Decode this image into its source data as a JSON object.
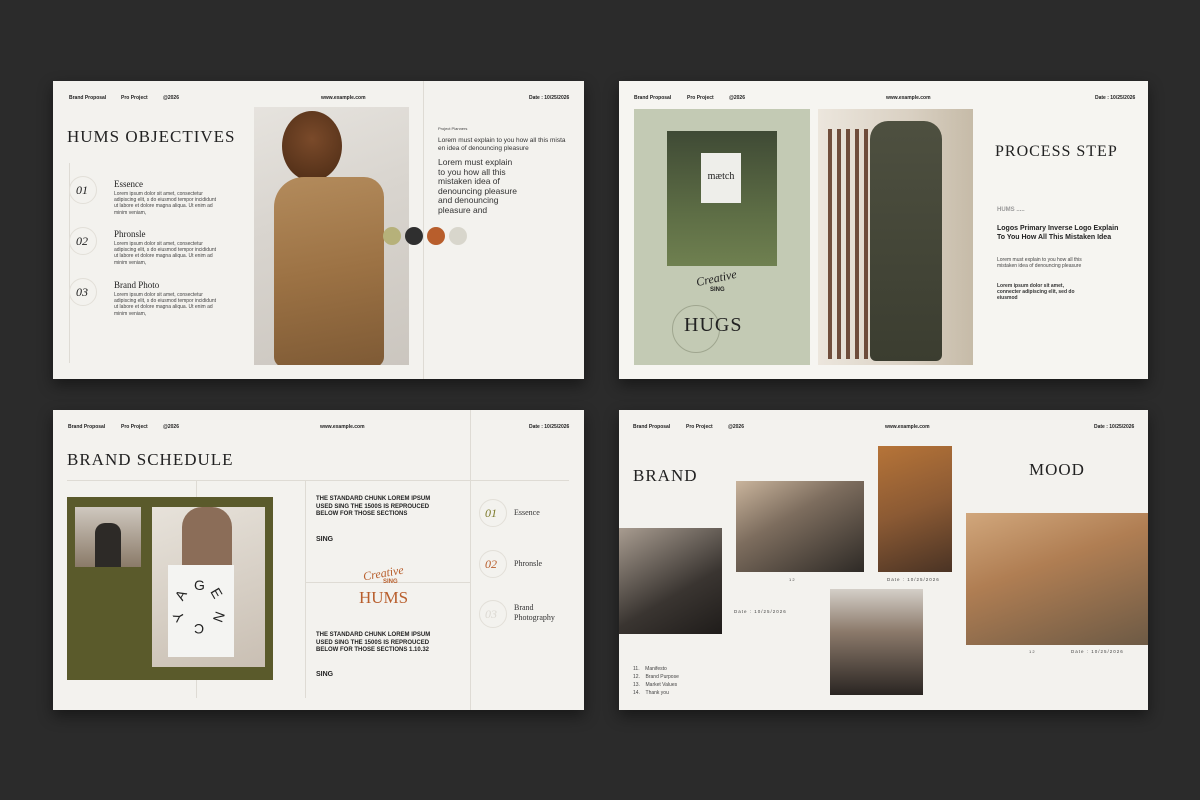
{
  "common": {
    "brand_proposal": "Brand Proposal",
    "pro_project": "Pro Project",
    "year": "@2026",
    "website": "www.example.com",
    "date": "Date : 10/25/2026"
  },
  "slide1": {
    "title": "HUMS OBJECTIVES",
    "project_label": "Project Planners",
    "intro_small": "Lorem must explain to you how all this mista en idea of denouncing pleasure",
    "intro_large": "Lorem must explain to you how all this mistaken idea of denouncing pleasure and denouncing pleasure and",
    "items": [
      {
        "num": "01",
        "heading": "Essence",
        "body": "Lorem ipsum dolor sit amet, consectetur adipiscing elit, s do eiusmod tempor incididunt ut labore et dolore magna aliqua. Ut enim ad minim veniam,"
      },
      {
        "num": "02",
        "heading": "Phronsle",
        "body": "Lorem ipsum dolor sit amet, consectetur adipiscing elit, s do eiusmod tempor incididunt ut labore et dolore magna aliqua. Ut enim ad minim veniam,"
      },
      {
        "num": "03",
        "heading": "Brand Photo",
        "body": "Lorem ipsum dolor sit amet, consectetur adipiscing elit, s do eiusmod tempor incididunt ut labore et dolore magna aliqua. Ut enim ad minim veniam,"
      }
    ],
    "swatches": [
      "#b6b17a",
      "#2f2f2f",
      "#b85e2c",
      "#d8d6cc"
    ]
  },
  "slide2": {
    "bag_text": "mætch",
    "script_text": "Creative",
    "sing": "SING",
    "hugs": "HUGS",
    "title": "PROCESS STEP",
    "label": "HUMS .....",
    "heading": "Logos Primary Inverse Logo Explain To You How All This Mistaken Idea",
    "para1": "Lorem must explain to you how all this mistaken idea of denouncing pleasure",
    "para2": "Lorem ipsum dolor sit amet, connecter adipiscing elit, sed do eiusmod"
  },
  "slide3": {
    "title": "BRAND SCHEDULE",
    "block1": "THE STANDARD CHUNK LOREM IPSUM USED SING THE 1500S IS REPROUCED BELOW FOR THOSE SECTIONS",
    "sing1": "SING",
    "script_text": "Creative",
    "script_sing": "SING",
    "hums": "HUMS",
    "block2": "THE STANDARD CHUNK LOREM IPSUM USED SING THE 1500S IS REPROUCED BELOW FOR THOSE SECTIONS 1.10.32",
    "sing2": "SING",
    "items": [
      {
        "num": "01",
        "label": "Essence"
      },
      {
        "num": "02",
        "label": "Phronsle"
      },
      {
        "num": "03",
        "label": "Brand Photography"
      }
    ],
    "tote_letters": [
      "A",
      "G",
      "E",
      "N",
      "C",
      "Y"
    ]
  },
  "slide4": {
    "brand": "BRAND",
    "mood": "MOOD",
    "date_a": "Date : 10/25/2026",
    "date_b": "Date : 10/25/2026",
    "date_c": "Date : 10/25/2026",
    "num_a": "1  2",
    "num_b": "1  2",
    "menu": [
      {
        "n": "11.",
        "label": "Manifesto"
      },
      {
        "n": "12.",
        "label": "Brand Purpose"
      },
      {
        "n": "13.",
        "label": "Market Values"
      },
      {
        "n": "14.",
        "label": "Thank you"
      }
    ]
  }
}
